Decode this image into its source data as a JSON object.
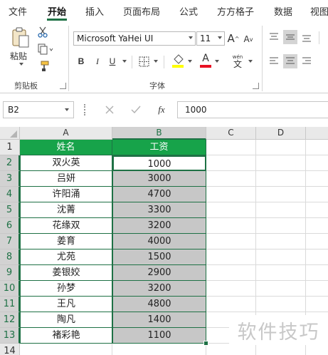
{
  "ribbon_tabs": [
    "文件",
    "开始",
    "插入",
    "页面布局",
    "公式",
    "方方格子",
    "数据",
    "视图"
  ],
  "clipboard": {
    "paste_label": "粘贴",
    "group_label": "剪贴板"
  },
  "font": {
    "family": "Microsoft YaHei UI",
    "size": "11",
    "bold": "B",
    "italic": "I",
    "underline": "U",
    "grow": "A",
    "shrink": "A",
    "font_color_letter": "A",
    "phonetic_top": "wén",
    "phonetic_bottom": "文",
    "group_label": "字体",
    "colors": {
      "highlight": "#ffff00",
      "font": "#e81123"
    }
  },
  "formula_bar": {
    "name_box": "B2",
    "fx": "fx",
    "value": "1000"
  },
  "sheet": {
    "columns": [
      "A",
      "B",
      "C",
      "D"
    ],
    "rows": [
      "1",
      "2",
      "3",
      "4",
      "5",
      "6",
      "7",
      "8",
      "9",
      "10",
      "11",
      "12",
      "13",
      "14"
    ],
    "header": [
      "姓名",
      "工资"
    ],
    "data": [
      [
        "双火英",
        "1000"
      ],
      [
        "吕妍",
        "3000"
      ],
      [
        "许阳涌",
        "4700"
      ],
      [
        "沈菁",
        "3300"
      ],
      [
        "花缘双",
        "3200"
      ],
      [
        "姜育",
        "4000"
      ],
      [
        "尤苑",
        "1500"
      ],
      [
        "姜银姣",
        "2900"
      ],
      [
        "孙梦",
        "3200"
      ],
      [
        "王凡",
        "4800"
      ],
      [
        "陶凡",
        "1400"
      ],
      [
        "褚彩艳",
        "1100"
      ]
    ],
    "colors": {
      "header_fill": "#17a34a",
      "selection_fill": "#c7c7c7",
      "accent": "#1e7145"
    }
  },
  "watermark": "软件技巧"
}
